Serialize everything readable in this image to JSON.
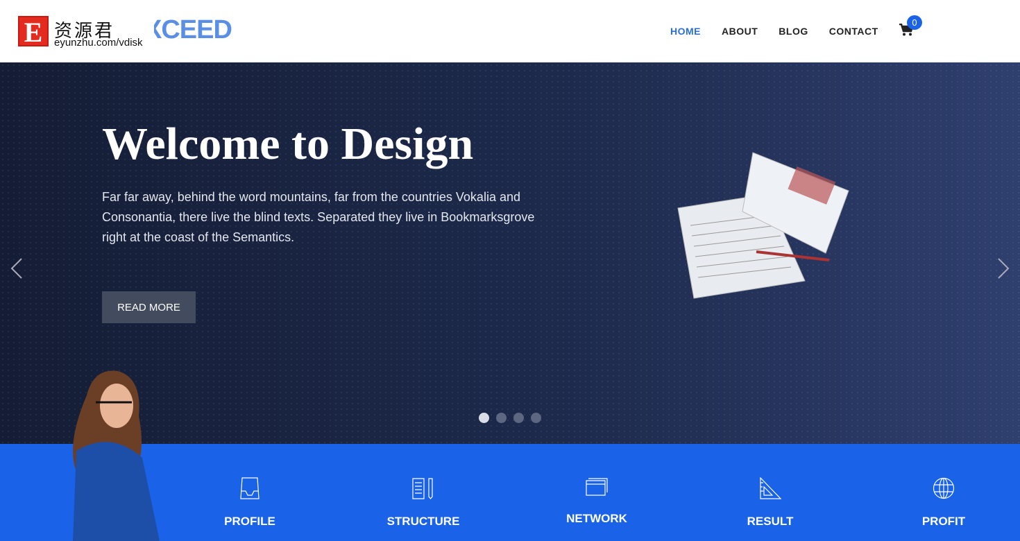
{
  "logo": {
    "mark": "E",
    "cn": "资源君",
    "url": "eyunzhu.com/vdisk",
    "brand": "XCEED"
  },
  "nav": [
    {
      "label": "HOME",
      "active": true
    },
    {
      "label": "ABOUT"
    },
    {
      "label": "BLOG"
    },
    {
      "label": "CONTACT"
    }
  ],
  "cart": {
    "icon": "cart-icon",
    "count": "0"
  },
  "hero": {
    "title": "Welcome to Design",
    "text": "Far far away, behind the word mountains, far from the countries Vokalia and Consonantia, there live the blind texts. Separated they live in Bookmarksgrove right at the coast of the Semantics.",
    "button": "READ MORE",
    "slides": 4,
    "active_slide": 1
  },
  "features": [
    {
      "label": "PROFILE",
      "icon": "inbox-tray-icon"
    },
    {
      "label": "STRUCTURE",
      "icon": "document-pencil-icon"
    },
    {
      "label": "NETWORK",
      "icon": "windows-icon"
    },
    {
      "label": "RESULT",
      "icon": "set-square-icon"
    },
    {
      "label": "PROFIT",
      "icon": "globe-icon"
    }
  ],
  "colors": {
    "accent": "#1a63e8",
    "hero_dark": "#151d35"
  }
}
